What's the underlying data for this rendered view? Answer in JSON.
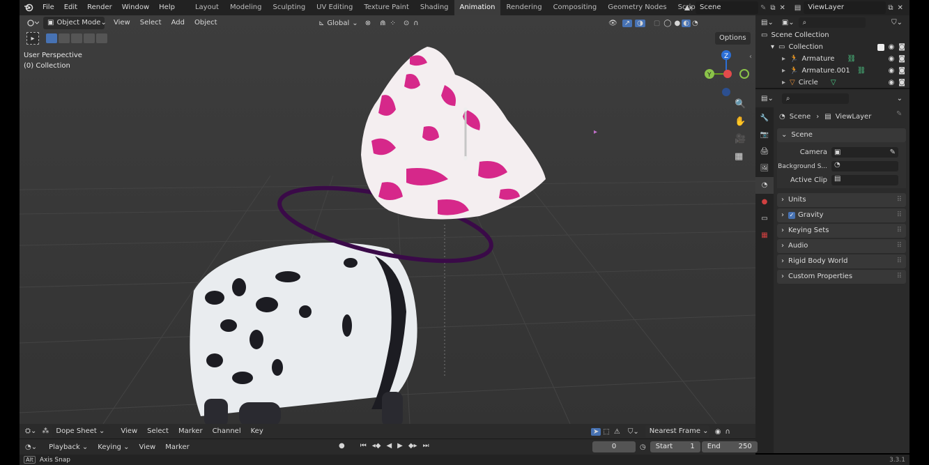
{
  "topbar": {
    "menus": [
      "File",
      "Edit",
      "Render",
      "Window",
      "Help"
    ],
    "workspaces": [
      "Layout",
      "Modeling",
      "Sculpting",
      "UV Editing",
      "Texture Paint",
      "Shading",
      "Animation",
      "Rendering",
      "Compositing",
      "Geometry Nodes",
      "Scripting"
    ],
    "active_workspace": "Animation",
    "add_workspace": "+",
    "scene": "Scene",
    "view_layer": "ViewLayer"
  },
  "viewport": {
    "mode": "Object Mode",
    "menus": [
      "View",
      "Select",
      "Add",
      "Object"
    ],
    "orientation": "Global",
    "options": "Options",
    "perspective": "User Perspective",
    "collection": "(0) Collection",
    "gizmo": {
      "z": "Z",
      "y": "Y"
    }
  },
  "outliner": {
    "scene_collection": "Scene Collection",
    "collection": "Collection",
    "objects": [
      {
        "name": "Armature"
      },
      {
        "name": "Armature.001"
      },
      {
        "name": "Circle"
      }
    ]
  },
  "properties": {
    "breadcrumb_scene": "Scene",
    "breadcrumb_layer": "ViewLayer",
    "scene_panel": "Scene",
    "camera_label": "Camera",
    "background_label": "Background S...",
    "active_clip_label": "Active Clip",
    "panels": [
      "Units",
      "Gravity",
      "Keying Sets",
      "Audio",
      "Rigid Body World",
      "Custom Properties"
    ],
    "gravity_checked": true
  },
  "timeline": {
    "editor": "Dope Sheet",
    "menus": [
      "View",
      "Select",
      "Marker",
      "Channel",
      "Key"
    ],
    "snap": "Nearest Frame",
    "playback": "Playback",
    "keying": "Keying",
    "view": "View",
    "marker": "Marker",
    "current_frame": "0",
    "start_label": "Start",
    "start_value": "1",
    "end_label": "End",
    "end_value": "250"
  },
  "status": {
    "hint_key": "Alt",
    "hint": "Axis Snap",
    "version": "3.3.1"
  },
  "colors": {
    "accent": "#4772b3",
    "active_tab": "#3c3c3c",
    "circle_object": "#4b0a5a",
    "pink_spots": "#e0389a"
  }
}
